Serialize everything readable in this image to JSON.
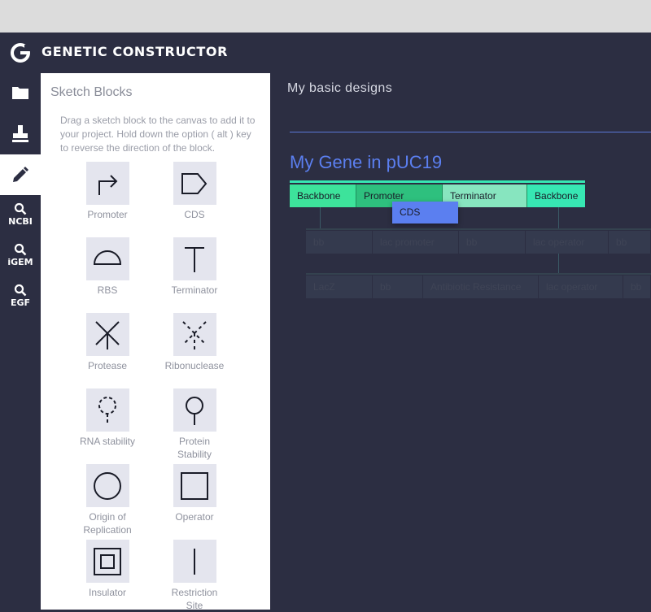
{
  "app": {
    "title": "GENETIC CONSTRUCTOR"
  },
  "iconbar": {
    "items": [
      {
        "icon": "folder-icon",
        "label": ""
      },
      {
        "icon": "stamp-icon",
        "label": ""
      },
      {
        "icon": "pencil-icon",
        "label": "",
        "active": true
      },
      {
        "icon": "search-icon",
        "label": "NCBI"
      },
      {
        "icon": "search-icon",
        "label": "iGEM"
      },
      {
        "icon": "search-icon",
        "label": "EGF"
      }
    ]
  },
  "sketch": {
    "title": "Sketch Blocks",
    "help": "Drag a sketch block to the canvas to add it to your project. Hold down the option ( alt ) key to reverse the direction of the block.",
    "blocks": [
      {
        "name": "Promoter",
        "icon": "promoter-icon"
      },
      {
        "name": "CDS",
        "icon": "cds-icon"
      },
      {
        "name": "RBS",
        "icon": "rbs-icon"
      },
      {
        "name": "Terminator",
        "icon": "terminator-icon"
      },
      {
        "name": "Protease",
        "icon": "protease-icon"
      },
      {
        "name": "Ribonuclease",
        "icon": "ribonuclease-icon"
      },
      {
        "name": "RNA stability",
        "icon": "rna-stability-icon"
      },
      {
        "name": "Protein Stability",
        "icon": "protein-stability-icon"
      },
      {
        "name": "Origin of Replication",
        "icon": "origin-of-replication-icon"
      },
      {
        "name": "Operator",
        "icon": "operator-icon"
      },
      {
        "name": "Insulator",
        "icon": "insulator-icon"
      },
      {
        "name": "Restriction Site",
        "icon": "restriction-site-icon"
      }
    ]
  },
  "canvas": {
    "project_title": "My basic designs",
    "construct_title": "My Gene in pUC19",
    "accent": "#5b7ff0",
    "row0": [
      {
        "label": "Backbone",
        "color": "#3de39b"
      },
      {
        "label": "Promoter",
        "color": "#2ec07e"
      },
      {
        "label": "Terminator",
        "color": "#87e5bf"
      },
      {
        "label": "Backbone",
        "color": "#37e7b3"
      }
    ],
    "row1": [
      "bb",
      "lac promoter",
      "bb",
      "lac operator",
      "bb"
    ],
    "row2": [
      "LacZ",
      "bb",
      "Antibiotic Resistance",
      "lac operator",
      "bb"
    ],
    "drag_ghost": "CDS"
  }
}
